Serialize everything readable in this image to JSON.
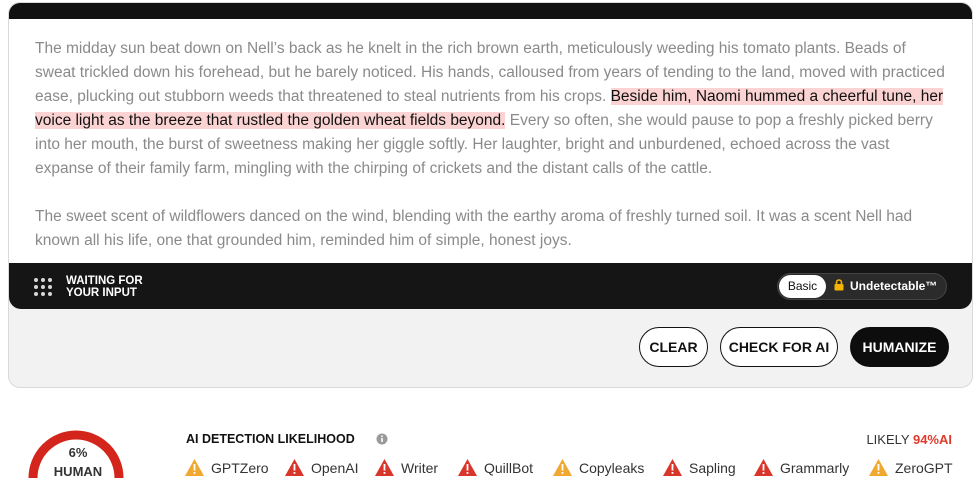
{
  "editor": {
    "paragraph1_before": "The midday sun beat down on Nell’s back as he knelt in the rich brown earth, meticulously weeding his tomato plants. Beads of sweat trickled down his forehead, but he barely noticed. His hands, calloused from years of tending to the land, moved with practiced ease, plucking out stubborn weeds that threatened to steal nutrients from his crops. ",
    "paragraph1_highlight": "Beside him, Naomi hummed a cheerful tune, her voice light as the breeze that rustled the golden wheat fields beyond.",
    "paragraph1_after": " Every so often, she would pause to pop a freshly picked berry into her mouth, the burst of sweetness making her giggle softly. Her laughter, bright and unburdened, echoed across the vast expanse of their family farm, mingling with the chirping of crickets and the distant calls of the cattle.",
    "paragraph2": " The sweet scent of wildflowers danced on the wind, blending with the earthy aroma of freshly turned soil. It was a scent Nell had known all his life, one that grounded him, reminded him of simple, honest joys."
  },
  "status": {
    "label": "Waiting for your input",
    "mode_basic": "Basic",
    "mode_undetectable": "Undetectable™"
  },
  "buttons": {
    "clear": "Clear",
    "check": "Check for AI",
    "humanize": "Humanize"
  },
  "result": {
    "human_percent": "6%",
    "human_label": "HUMAN",
    "human_fraction": 0.06,
    "detection_title": "AI Detection Likelihood",
    "likely_prefix": "Likely",
    "likely_value": "94%AI"
  },
  "detectors": [
    {
      "name": "GPTZero",
      "status": "warning",
      "color": "#f0a830"
    },
    {
      "name": "OpenAI",
      "status": "alert",
      "color": "#d9362b"
    },
    {
      "name": "Writer",
      "status": "alert",
      "color": "#d9362b"
    },
    {
      "name": "QuillBot",
      "status": "alert",
      "color": "#d9362b"
    },
    {
      "name": "Copyleaks",
      "status": "warning",
      "color": "#f0a830"
    },
    {
      "name": "Sapling",
      "status": "alert",
      "color": "#d9362b"
    },
    {
      "name": "Grammarly",
      "status": "alert",
      "color": "#d9362b"
    },
    {
      "name": "ZeroGPT",
      "status": "warning",
      "color": "#f0a830"
    }
  ],
  "colors": {
    "highlight": "#fbd3d3",
    "ai_red": "#e03a2e",
    "gauge_red": "#d4251c",
    "dark": "#111111"
  }
}
